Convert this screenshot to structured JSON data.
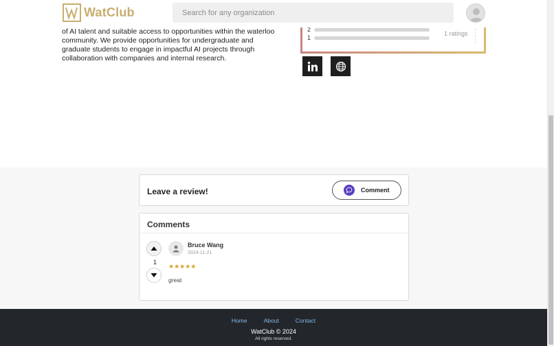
{
  "header": {
    "logo_text": "WatClub",
    "search_placeholder": "Search for any organization"
  },
  "club": {
    "description": "of AI talent and suitable access to opportunities within the waterloo community. We provide opportunities for undergraduate and graduate students to engage in impactful AI projects through collaboration with companies and internal research."
  },
  "ratings": {
    "rows": [
      {
        "label": "2",
        "fraction": 0
      },
      {
        "label": "1",
        "fraction": 0
      }
    ],
    "count_text": "1 ratings"
  },
  "social": {
    "icons": [
      "linkedin-icon",
      "globe-icon"
    ]
  },
  "review": {
    "title": "Leave a review!",
    "comment_button_label": "Comment"
  },
  "comments": {
    "title": "Comments",
    "items": [
      {
        "votes": "1",
        "author": "Bruce Wang",
        "date": "2024-11-21",
        "stars": "★★★★★",
        "text": "great"
      }
    ]
  },
  "footer": {
    "links": [
      "Home",
      "About",
      "Contact"
    ],
    "copyright": "WatClub © 2024",
    "rights": "All rights reserved."
  },
  "colors": {
    "brand_gold": "#c9ad6e",
    "accent_purple": "#5a3fc0",
    "footer_bg": "#23272b",
    "link_blue": "#7fb6e8"
  }
}
